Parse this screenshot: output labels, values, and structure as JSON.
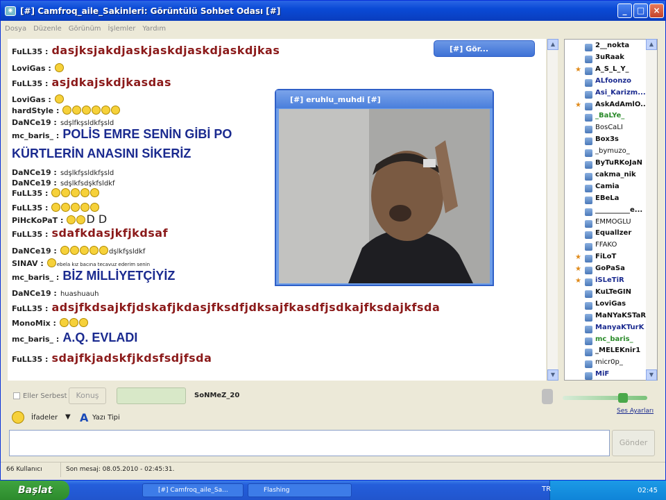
{
  "window": {
    "title": "[#] Camfroq_aile_Sakinleri: Görüntülü Sohbet Odası [#]",
    "minimize": "_",
    "maximize": "□",
    "close": "×"
  },
  "menu": [
    "Dosya",
    "Düzenle",
    "Görünüm",
    "İşlemler",
    "Yardım"
  ],
  "chat": [
    {
      "nick": "FuLL35 :",
      "text": "dasjksjakdjaskjaskdjaskdjaskdjkas",
      "style": "red"
    },
    {
      "nick": "LoviGas :",
      "text": "",
      "emojis": 1
    },
    {
      "nick": "FuLL35 :",
      "text": "asjdkajskdjkasdas",
      "style": "red"
    },
    {
      "nick": "LoviGas :",
      "text": "",
      "emojis": 1
    },
    {
      "nick": "hardStyle :",
      "text": "",
      "emojis": 6
    },
    {
      "nick": "DaNCe19 :",
      "text": "sdşlfkşsldkfşsld",
      "style": "sm"
    },
    {
      "nick": "mc_baris_ :",
      "text": "POLİS EMRE SENİN GİBİ  PO",
      "style": "blue"
    },
    {
      "nick": "",
      "text": "KÜRTLERİN ANASINI SİKERİZ",
      "style": "blue"
    },
    {
      "nick": "DaNCe19 :",
      "text": "sdşlkfşsldkfşsld",
      "style": "sm"
    },
    {
      "nick": "DaNCe19 :",
      "text": "sdşlkfsdşkfsldkf",
      "style": "sm"
    },
    {
      "nick": "FuLL35 :",
      "text": "",
      "emojis": 5
    },
    {
      "nick": "FuLL35 :",
      "text": "",
      "emojis": 5
    },
    {
      "nick": "PiHcKoPaT :",
      "text": "D  D",
      "emojis": 2
    },
    {
      "nick": "FuLL35 :",
      "text": "sdafkdasjkfjkdsaf",
      "style": "red"
    },
    {
      "nick": "DaNCe19 :",
      "text": "dşlkfşsldkf",
      "emojis": 5,
      "style": "sm"
    },
    {
      "nick": "SINAV :",
      "text": "ebela kız bacına tecavuz ederim senin",
      "style": "tiny",
      "emojis": 1
    },
    {
      "nick": "mc_baris_ :",
      "text": "BİZ MİLLİYETÇİYİZ",
      "style": "blue"
    },
    {
      "nick": "DaNCe19 :",
      "text": "huashuauh",
      "style": "sm"
    },
    {
      "nick": "FuLL35 :",
      "text": "adsjfkdsajkfjdskafjkdasjfksdfjdksajfkasdfjsdkajfksdajkfsda",
      "style": "red"
    },
    {
      "nick": "MonoMix :",
      "text": "",
      "emojis": 3
    },
    {
      "nick": "mc_baris_ :",
      "text": "A.Q. EVLADI",
      "style": "blue"
    },
    {
      "nick": "FuLL35 :",
      "text": "sdajfkjadskfjkdsfsdjfsda",
      "style": "red"
    }
  ],
  "video": {
    "title": "[#] eruhlu_muhdi [#]"
  },
  "mini": {
    "title": "[#] Gör..."
  },
  "users": [
    {
      "name": "2__nokta",
      "color": "#111"
    },
    {
      "name": "3uRaak",
      "color": "#111"
    },
    {
      "name": "A_S_L_Y_",
      "color": "#111",
      "star": true
    },
    {
      "name": "ALfoonzo",
      "color": "#1a2a8f"
    },
    {
      "name": "Asi_Karizm...",
      "color": "#1a2a8f"
    },
    {
      "name": "AskAdAmlO...",
      "color": "#111",
      "star": true
    },
    {
      "name": "_BaLYe_",
      "color": "#2a8a2a"
    },
    {
      "name": "BosCaLI",
      "color": "#111",
      "light": true
    },
    {
      "name": "Box3s",
      "color": "#111"
    },
    {
      "name": "_bymuzo_",
      "color": "#111",
      "light": true
    },
    {
      "name": "ByTuRKoJaN",
      "color": "#111"
    },
    {
      "name": "cakma_nik",
      "color": "#111"
    },
    {
      "name": "Camia",
      "color": "#111"
    },
    {
      "name": "EBeLa",
      "color": "#111"
    },
    {
      "name": "__________e...",
      "color": "#111"
    },
    {
      "name": "EMMOGLU",
      "color": "#111",
      "light": true
    },
    {
      "name": "Equallzer",
      "color": "#111"
    },
    {
      "name": "FFAKO",
      "color": "#111",
      "light": true
    },
    {
      "name": "FiLoT",
      "color": "#111",
      "star": true
    },
    {
      "name": "GoPaSa",
      "color": "#111",
      "star": true
    },
    {
      "name": "iSLeTiR",
      "color": "#1a2a8f",
      "star": true
    },
    {
      "name": "KuLTeGIN",
      "color": "#111"
    },
    {
      "name": "LoviGas",
      "color": "#111"
    },
    {
      "name": "MaNYaKSTaR",
      "color": "#111"
    },
    {
      "name": "ManyaKTurK",
      "color": "#1a2a8f"
    },
    {
      "name": "mc_baris_",
      "color": "#2a8a2a"
    },
    {
      "name": "_MELEKnir1",
      "color": "#111"
    },
    {
      "name": "micr0p_",
      "color": "#111",
      "light": true
    },
    {
      "name": "MiF",
      "color": "#1a2a8f"
    }
  ],
  "controls": {
    "eller": "Eller Serbest",
    "konus": "Konuş",
    "speaker": "SoNMeZ_20",
    "ses": "Ses Ayarları"
  },
  "input": {
    "ifadeler": "İfadeler",
    "yazi": "Yazı Tipi",
    "send": "Gönder"
  },
  "status": {
    "users": "66 Kullanıcı",
    "last": "Son mesaj: 08.05.2010 - 02:45:31."
  },
  "taskbar": {
    "start": "Başlat",
    "task1": "[#] Camfroq_aile_Sa...",
    "task2": "Flashing",
    "lang": "TR",
    "clock": "02:45"
  }
}
